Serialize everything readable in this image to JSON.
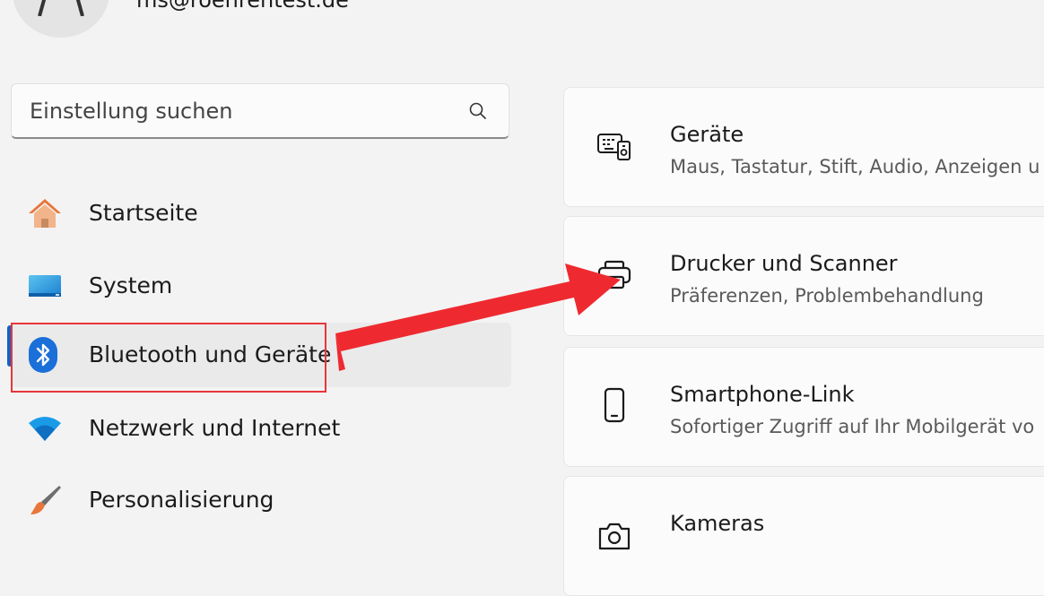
{
  "account": {
    "email": "ms@roehrentest.de"
  },
  "search": {
    "placeholder": "Einstellung suchen"
  },
  "sidebar": {
    "items": [
      {
        "label": "Startseite"
      },
      {
        "label": "System"
      },
      {
        "label": "Bluetooth und Geräte",
        "selected": true
      },
      {
        "label": "Netzwerk und Internet"
      },
      {
        "label": "Personalisierung"
      }
    ]
  },
  "main": {
    "cards": [
      {
        "title": "Geräte",
        "subtitle": "Maus, Tastatur, Stift, Audio, Anzeigen u"
      },
      {
        "title": "Drucker und Scanner",
        "subtitle": "Präferenzen, Problembehandlung"
      },
      {
        "title": "Smartphone-Link",
        "subtitle": "Sofortiger Zugriff auf Ihr Mobilgerät vo"
      },
      {
        "title": "Kameras",
        "subtitle": ""
      }
    ]
  },
  "colors": {
    "accent": "#1660c4",
    "annotation": "#e8363a",
    "background": "#f3f3f3"
  }
}
